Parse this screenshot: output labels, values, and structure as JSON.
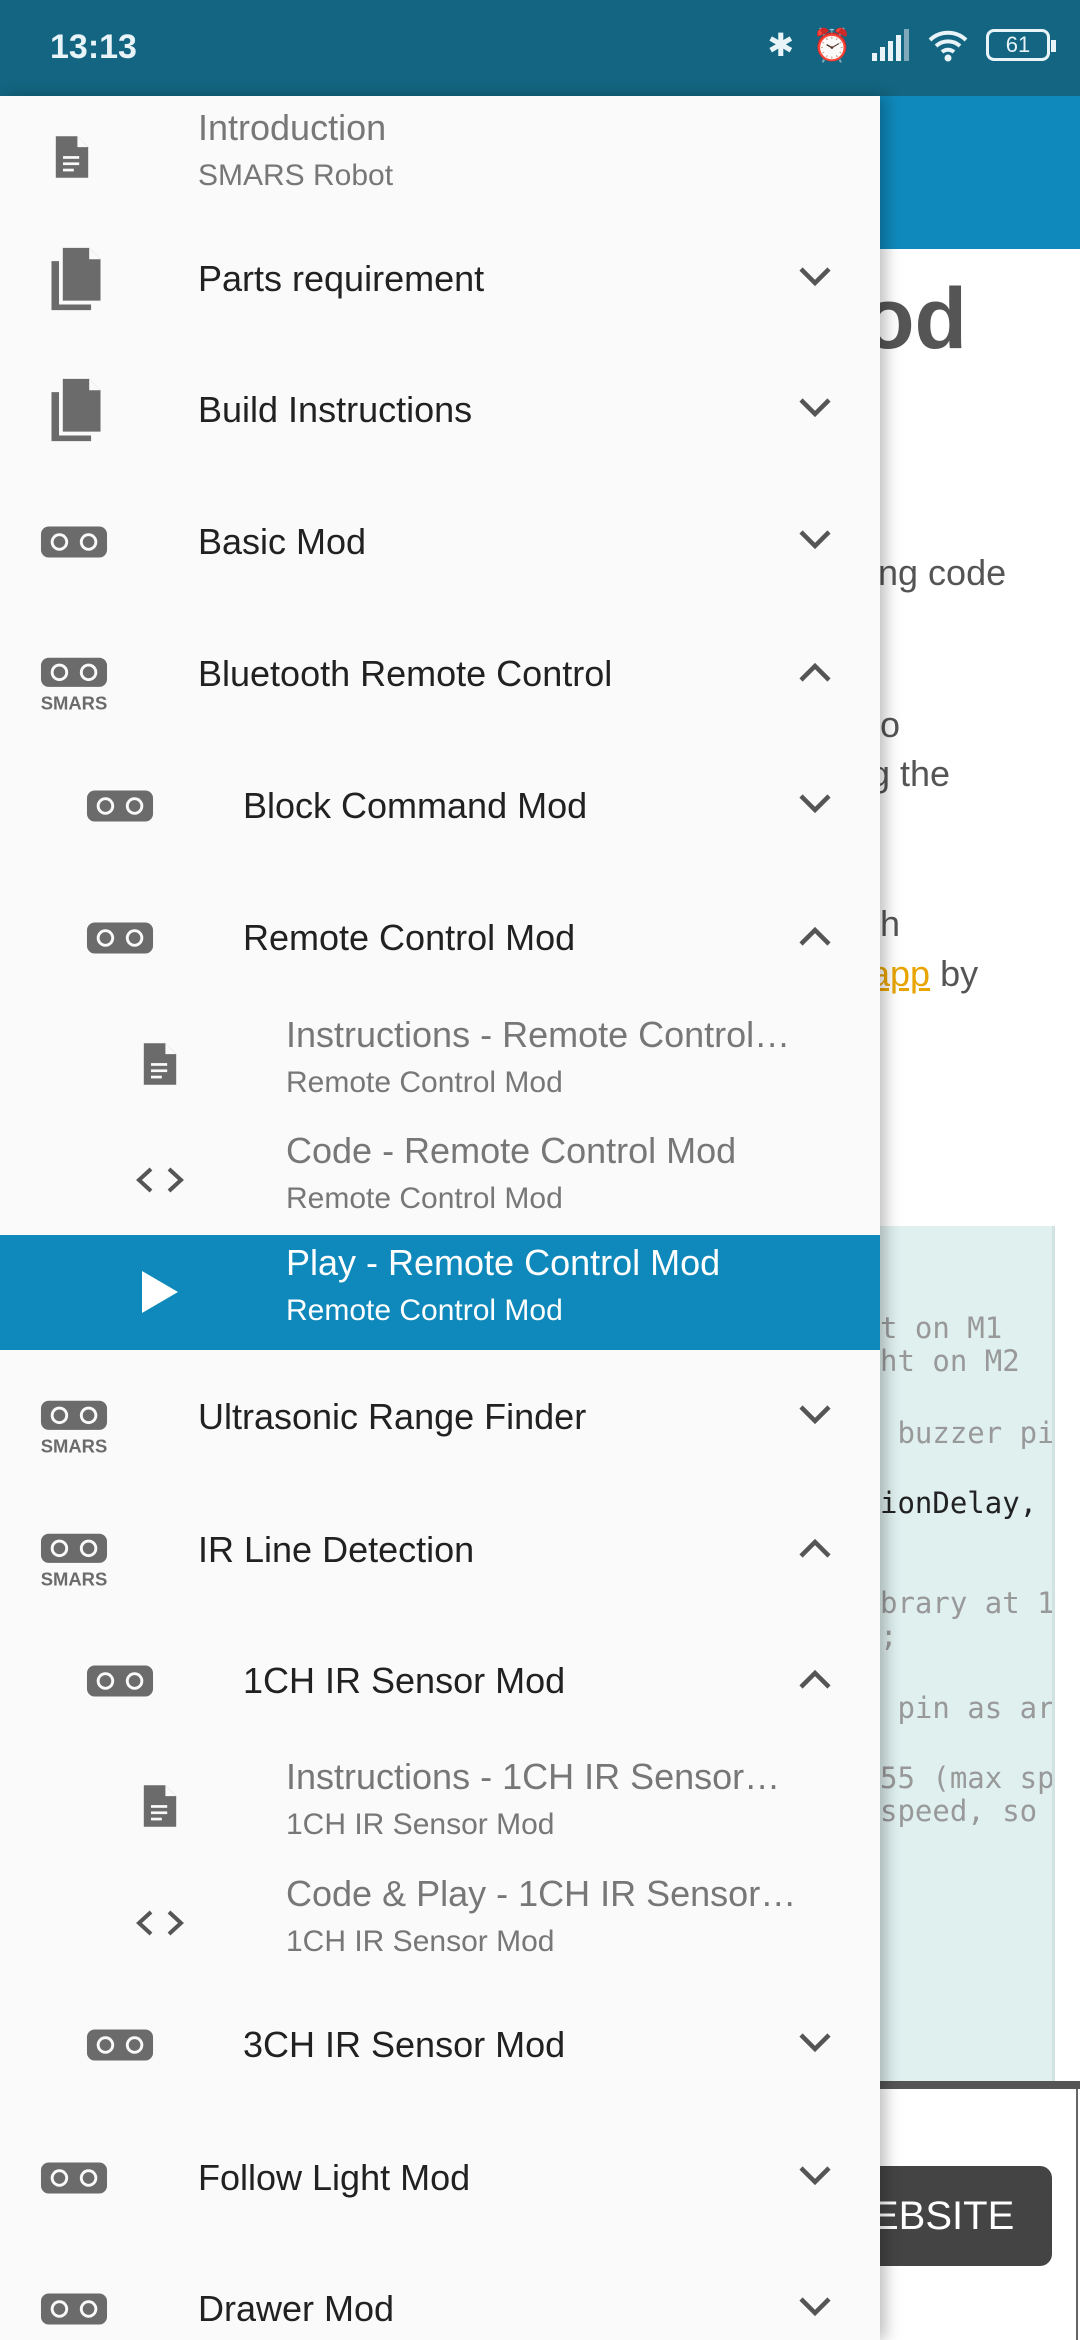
{
  "status_bar": {
    "time": "13:13",
    "battery": "61",
    "icons": [
      "bluetooth-icon",
      "alarm-icon",
      "signal-icon",
      "wifi-icon",
      "battery-icon"
    ]
  },
  "background": {
    "heading_fragment": "od",
    "text_lines": [
      "ing code",
      "to",
      "g the",
      "th"
    ],
    "link_text": "app",
    "after_link": " by",
    "code_lines": [
      "t on M1",
      "ht on M2",
      " buzzer pi",
      "ionDelay,",
      "brary at 1",
      ";",
      " pin as ar",
      "55 (max sp",
      "speed, so"
    ],
    "button_label": "EBSITE"
  },
  "drawer": {
    "accent": "#0f89bb",
    "items": [
      {
        "label": "Introduction",
        "sub": "SMARS Robot",
        "icon": "document-icon"
      },
      {
        "label": "Parts requirement",
        "icon": "copy-icon",
        "state": "collapsed"
      },
      {
        "label": "Build Instructions",
        "icon": "copy-icon",
        "state": "collapsed"
      },
      {
        "label": "Basic Mod",
        "icon": "robot-icon",
        "state": "collapsed"
      },
      {
        "label": "Bluetooth Remote Control",
        "icon": "smars-icon",
        "state": "expanded"
      },
      {
        "label": "Block Command Mod",
        "icon": "robot-icon",
        "state": "collapsed"
      },
      {
        "label": "Remote Control Mod",
        "icon": "robot-icon",
        "state": "expanded"
      },
      {
        "label": "Instructions - Remote Control…",
        "sub": "Remote Control Mod",
        "icon": "document-icon"
      },
      {
        "label": "Code - Remote Control Mod",
        "sub": "Remote Control Mod",
        "icon": "code-icon"
      },
      {
        "label": "Play - Remote Control Mod",
        "sub": "Remote Control Mod",
        "icon": "play-icon",
        "selected": true
      },
      {
        "label": "Ultrasonic Range Finder",
        "icon": "smars-icon",
        "state": "collapsed"
      },
      {
        "label": "IR Line Detection",
        "icon": "smars-icon",
        "state": "expanded"
      },
      {
        "label": "1CH IR Sensor Mod",
        "icon": "robot-icon",
        "state": "expanded"
      },
      {
        "label": "Instructions - 1CH IR Sensor…",
        "sub": "1CH IR Sensor Mod",
        "icon": "document-icon"
      },
      {
        "label": "Code & Play - 1CH IR Sensor…",
        "sub": "1CH IR Sensor Mod",
        "icon": "code-icon"
      },
      {
        "label": "3CH IR Sensor Mod",
        "icon": "robot-icon",
        "state": "collapsed"
      },
      {
        "label": "Follow Light Mod",
        "icon": "robot-icon",
        "state": "collapsed"
      },
      {
        "label": "Drawer Mod",
        "icon": "robot-icon",
        "state": "collapsed"
      }
    ]
  }
}
